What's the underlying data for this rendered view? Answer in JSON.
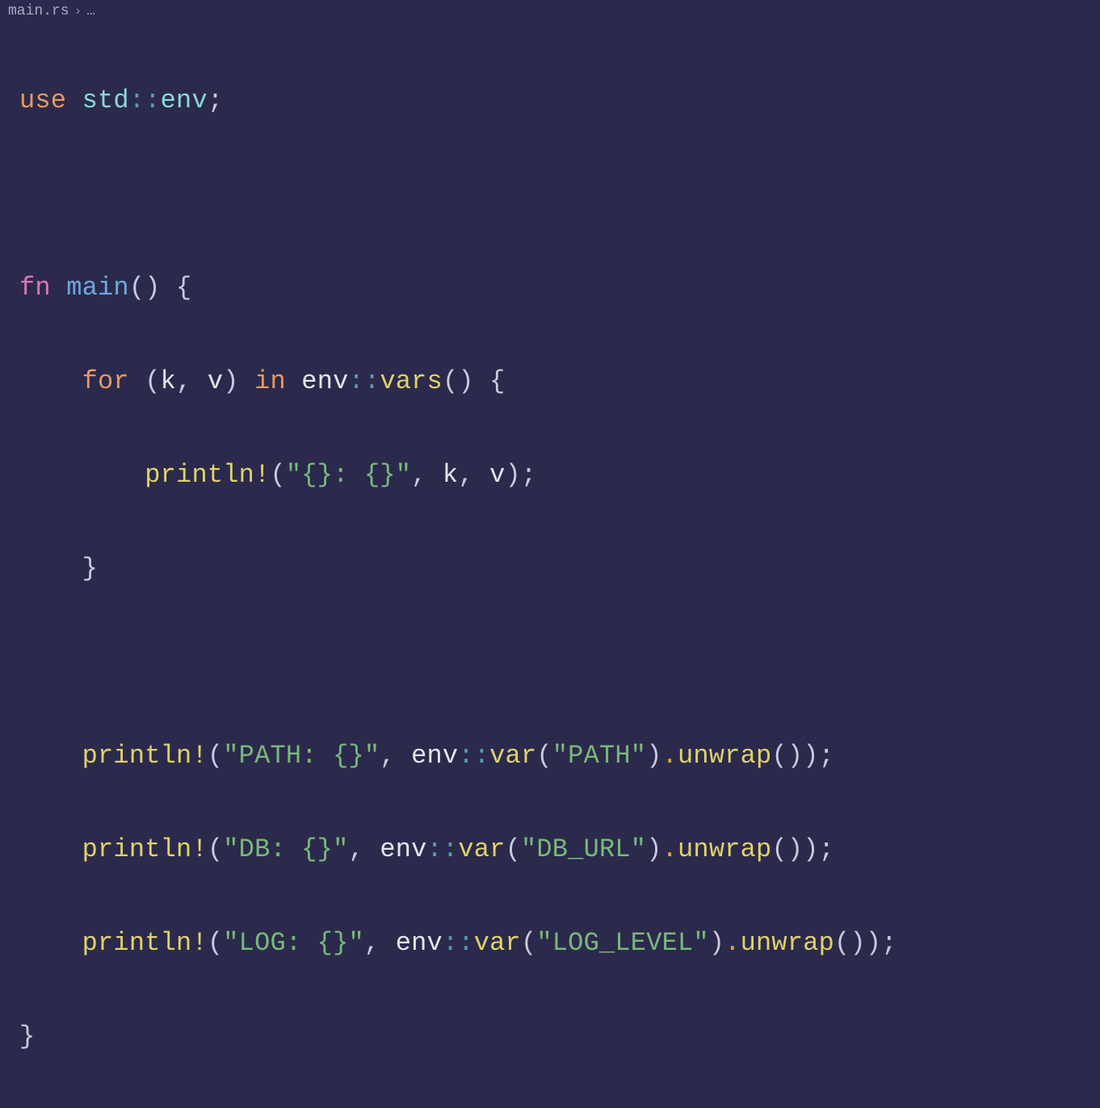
{
  "breadcrumb": {
    "file": "main.rs",
    "separator": "›",
    "ellipsis": "…"
  },
  "code": {
    "line1": {
      "use": "use",
      "std": "std",
      "dcolon": "::",
      "env": "env",
      "semi": ";"
    },
    "line3": {
      "fn": "fn",
      "main": "main",
      "parens": "()",
      "brace": " {"
    },
    "line4": {
      "for": "for",
      "tuple_open": " (",
      "k": "k",
      "comma": ", ",
      "v": "v",
      "tuple_close": ") ",
      "in": "in",
      "env": " env",
      "dcolon": "::",
      "vars": "vars",
      "call": "() {"
    },
    "line5": {
      "println": "println!",
      "open": "(",
      "str": "\"{}: {}\"",
      "comma1": ", ",
      "k": "k",
      "comma2": ", ",
      "v": "v",
      "close": ");"
    },
    "line6": {
      "brace": "}"
    },
    "line8": {
      "println": "println!",
      "open": "(",
      "str": "\"PATH: {}\"",
      "comma": ", ",
      "env": "env",
      "dcolon": "::",
      "var": "var",
      "popen": "(",
      "arg": "\"PATH\"",
      "pclose": ")",
      "dot": ".",
      "unwrap": "unwrap",
      "tail": "());"
    },
    "line9": {
      "println": "println!",
      "open": "(",
      "str": "\"DB: {}\"",
      "comma": ", ",
      "env": "env",
      "dcolon": "::",
      "var": "var",
      "popen": "(",
      "arg": "\"DB_URL\"",
      "pclose": ")",
      "dot": ".",
      "unwrap": "unwrap",
      "tail": "());"
    },
    "line10": {
      "println": "println!",
      "open": "(",
      "str": "\"LOG: {}\"",
      "comma": ", ",
      "env": "env",
      "dcolon": "::",
      "var": "var",
      "popen": "(",
      "arg": "\"LOG_LEVEL\"",
      "pclose": ")",
      "dot": ".",
      "unwrap": "unwrap",
      "tail": "());"
    },
    "line11": {
      "brace": "}"
    }
  }
}
